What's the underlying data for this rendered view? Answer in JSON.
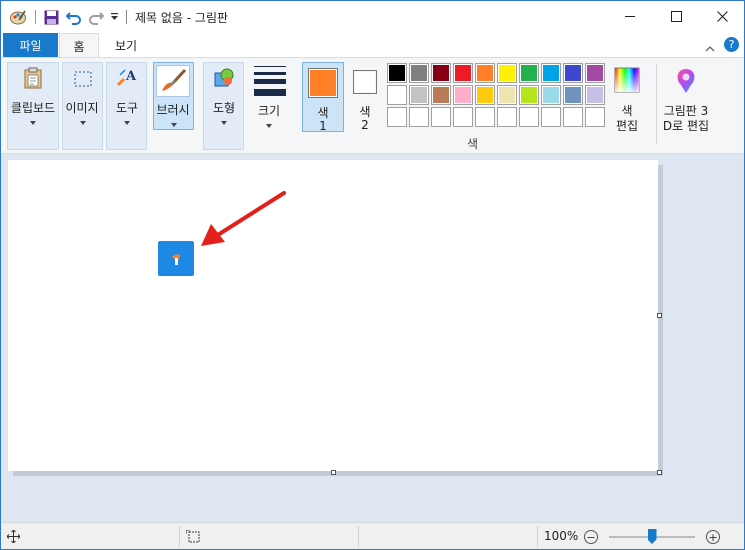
{
  "window": {
    "title": "제목 없음 - 그림판"
  },
  "tabs": {
    "file": "파일",
    "home": "홈",
    "view": "보기"
  },
  "ribbon": {
    "clipboard_label": "클립보드",
    "image_label": "이미지",
    "tools_label": "도구",
    "brushes_label": "브러시",
    "shapes_label": "도형",
    "size_label": "크기",
    "color1_label_line1": "색",
    "color1_label_line2": "1",
    "color2_label_line1": "색",
    "color2_label_line2": "2",
    "colors_section_label": "색",
    "edit_colors_line1": "색",
    "edit_colors_line2": "편집",
    "paint3d_line1": "그림판 3",
    "paint3d_line2": "D로 편집"
  },
  "colors": {
    "color1": "#ff7f27",
    "color2": "#ffffff",
    "palette_row1": [
      "#000000",
      "#7f7f7f",
      "#880015",
      "#ed1c24",
      "#ff7f27",
      "#fff200",
      "#22b14c",
      "#00a2e8",
      "#3f48cc",
      "#a349a4"
    ],
    "palette_row2": [
      "#ffffff",
      "#c3c3c3",
      "#b97a57",
      "#ffaec9",
      "#ffc90e",
      "#efe4b0",
      "#b5e61d",
      "#99d9ea",
      "#7092be",
      "#c8bfe7"
    ],
    "palette_row3": [
      "",
      "",
      "",
      "",
      "",
      "",
      "",
      "",
      "",
      ""
    ],
    "accent": "#1979ca",
    "annotation_arrow": "#e3201b"
  },
  "status": {
    "zoom": "100%",
    "zoom_fraction": 0.5
  }
}
